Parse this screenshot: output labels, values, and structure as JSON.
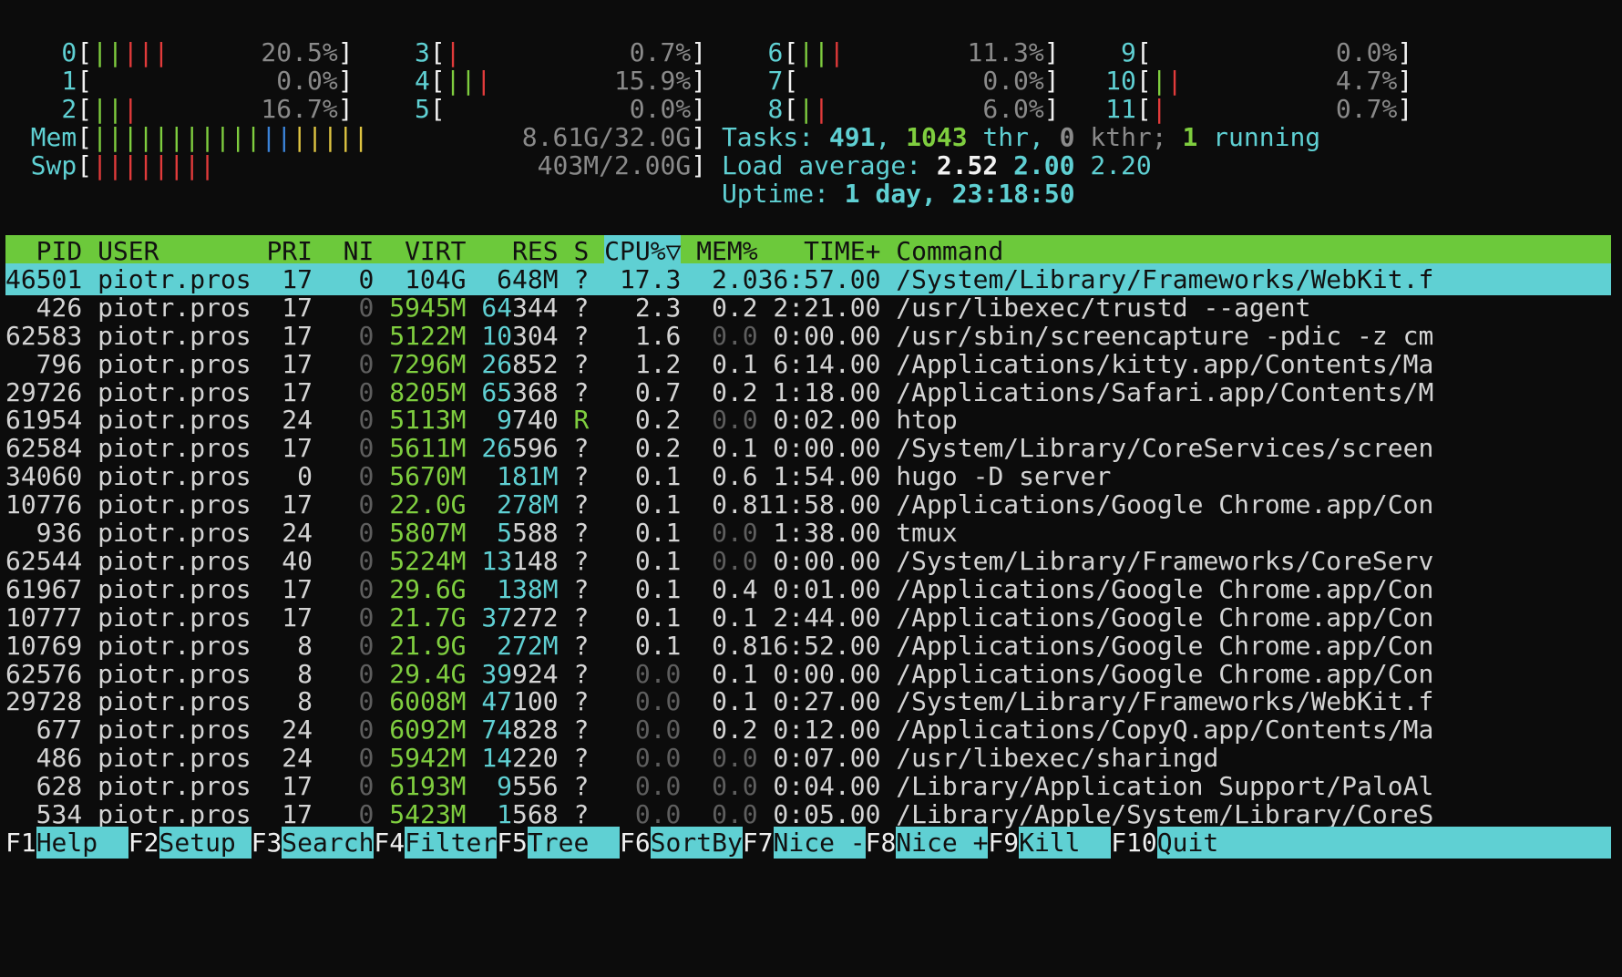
{
  "meters": {
    "cpus": [
      {
        "id": "0",
        "value": "20.5%",
        "bars": [
          [
            "green",
            2
          ],
          [
            "red",
            3
          ]
        ]
      },
      {
        "id": "1",
        "value": "0.0%",
        "bars": []
      },
      {
        "id": "2",
        "value": "16.7%",
        "bars": [
          [
            "green",
            2
          ],
          [
            "red",
            1
          ]
        ]
      },
      {
        "id": "3",
        "value": "0.7%",
        "bars": [
          [
            "red",
            1
          ]
        ]
      },
      {
        "id": "4",
        "value": "15.9%",
        "bars": [
          [
            "green",
            2
          ],
          [
            "red",
            1
          ]
        ]
      },
      {
        "id": "5",
        "value": "0.0%",
        "bars": []
      },
      {
        "id": "6",
        "value": "11.3%",
        "bars": [
          [
            "green",
            2
          ],
          [
            "red",
            1
          ]
        ]
      },
      {
        "id": "7",
        "value": "0.0%",
        "bars": []
      },
      {
        "id": "8",
        "value": "6.0%",
        "bars": [
          [
            "green",
            1
          ],
          [
            "red",
            1
          ]
        ]
      },
      {
        "id": "9",
        "value": "0.0%",
        "bars": []
      },
      {
        "id": "10",
        "value": "4.7%",
        "bars": [
          [
            "green",
            1
          ],
          [
            "red",
            1
          ]
        ]
      },
      {
        "id": "11",
        "value": "0.7%",
        "bars": [
          [
            "red",
            1
          ]
        ]
      }
    ],
    "mem": {
      "label": "Mem",
      "value": "8.61G/32.0G",
      "bars": [
        [
          "green",
          11
        ],
        [
          "blue",
          2
        ],
        [
          "yellow",
          5
        ]
      ]
    },
    "swp": {
      "label": "Swp",
      "value": "403M/2.00G",
      "bars": [
        [
          "red",
          8
        ]
      ]
    },
    "tasks": {
      "label": "Tasks: ",
      "tasks": "491",
      "sep1": ", ",
      "thr": "1043",
      "thr_label": " thr, ",
      "kthr": "0",
      "kthr_label": " kthr; ",
      "running": "1",
      "running_label": " running"
    },
    "load": {
      "label": "Load average: ",
      "l1": "2.52",
      "l5": "2.00",
      "l15": "2.20"
    },
    "uptime": {
      "label": "Uptime: ",
      "value": "1 day, 23:18:50"
    }
  },
  "table": {
    "columns": [
      "PID",
      "USER",
      "PRI",
      "NI",
      "VIRT",
      "RES",
      "S",
      "CPU%▽",
      "MEM%",
      "TIME+",
      "Command"
    ],
    "rows": [
      [
        "46501",
        "piotr.pros",
        "17",
        "0",
        "104G",
        "648M",
        "?",
        "17.3",
        "2.0",
        "36:57.00",
        "/System/Library/Frameworks/WebKit.f"
      ],
      [
        "426",
        "piotr.pros",
        "17",
        "0",
        "5945M",
        "64344",
        "?",
        "2.3",
        "0.2",
        "2:21.00",
        "/usr/libexec/trustd --agent"
      ],
      [
        "62583",
        "piotr.pros",
        "17",
        "0",
        "5122M",
        "10304",
        "?",
        "1.6",
        "0.0",
        "0:00.00",
        "/usr/sbin/screencapture -pdic -z cm"
      ],
      [
        "796",
        "piotr.pros",
        "17",
        "0",
        "7296M",
        "26852",
        "?",
        "1.2",
        "0.1",
        "6:14.00",
        "/Applications/kitty.app/Contents/Ma"
      ],
      [
        "29726",
        "piotr.pros",
        "17",
        "0",
        "8205M",
        "65368",
        "?",
        "0.7",
        "0.2",
        "1:18.00",
        "/Applications/Safari.app/Contents/M"
      ],
      [
        "61954",
        "piotr.pros",
        "24",
        "0",
        "5113M",
        "9740",
        "R",
        "0.2",
        "0.0",
        "0:02.00",
        "htop"
      ],
      [
        "62584",
        "piotr.pros",
        "17",
        "0",
        "5611M",
        "26596",
        "?",
        "0.2",
        "0.1",
        "0:00.00",
        "/System/Library/CoreServices/screen"
      ],
      [
        "34060",
        "piotr.pros",
        "0",
        "0",
        "5670M",
        "181M",
        "?",
        "0.1",
        "0.6",
        "1:54.00",
        "hugo -D server"
      ],
      [
        "10776",
        "piotr.pros",
        "17",
        "0",
        "22.0G",
        "278M",
        "?",
        "0.1",
        "0.8",
        "11:58.00",
        "/Applications/Google Chrome.app/Con"
      ],
      [
        "936",
        "piotr.pros",
        "24",
        "0",
        "5807M",
        "5588",
        "?",
        "0.1",
        "0.0",
        "1:38.00",
        "tmux"
      ],
      [
        "62544",
        "piotr.pros",
        "40",
        "0",
        "5224M",
        "13148",
        "?",
        "0.1",
        "0.0",
        "0:00.00",
        "/System/Library/Frameworks/CoreServ"
      ],
      [
        "61967",
        "piotr.pros",
        "17",
        "0",
        "29.6G",
        "138M",
        "?",
        "0.1",
        "0.4",
        "0:01.00",
        "/Applications/Google Chrome.app/Con"
      ],
      [
        "10777",
        "piotr.pros",
        "17",
        "0",
        "21.7G",
        "37272",
        "?",
        "0.1",
        "0.1",
        "2:44.00",
        "/Applications/Google Chrome.app/Con"
      ],
      [
        "10769",
        "piotr.pros",
        "8",
        "0",
        "21.9G",
        "272M",
        "?",
        "0.1",
        "0.8",
        "16:52.00",
        "/Applications/Google Chrome.app/Con"
      ],
      [
        "62576",
        "piotr.pros",
        "8",
        "0",
        "29.4G",
        "39924",
        "?",
        "0.0",
        "0.1",
        "0:00.00",
        "/Applications/Google Chrome.app/Con"
      ],
      [
        "29728",
        "piotr.pros",
        "8",
        "0",
        "6008M",
        "47100",
        "?",
        "0.0",
        "0.1",
        "0:27.00",
        "/System/Library/Frameworks/WebKit.f"
      ],
      [
        "677",
        "piotr.pros",
        "24",
        "0",
        "6092M",
        "74828",
        "?",
        "0.0",
        "0.2",
        "0:12.00",
        "/Applications/CopyQ.app/Contents/Ma"
      ],
      [
        "486",
        "piotr.pros",
        "24",
        "0",
        "5942M",
        "14220",
        "?",
        "0.0",
        "0.0",
        "0:07.00",
        "/usr/libexec/sharingd"
      ],
      [
        "628",
        "piotr.pros",
        "17",
        "0",
        "6193M",
        "9556",
        "?",
        "0.0",
        "0.0",
        "0:04.00",
        "/Library/Application Support/PaloAl"
      ],
      [
        "534",
        "piotr.pros",
        "17",
        "0",
        "5423M",
        "1568",
        "?",
        "0.0",
        "0.0",
        "0:05.00",
        "/Library/Apple/System/Library/CoreS"
      ]
    ]
  },
  "function_keys": [
    {
      "key": "F1",
      "label": "Help  "
    },
    {
      "key": "F2",
      "label": "Setup "
    },
    {
      "key": "F3",
      "label": "Search"
    },
    {
      "key": "F4",
      "label": "Filter"
    },
    {
      "key": "F5",
      "label": "Tree  "
    },
    {
      "key": "F6",
      "label": "SortBy"
    },
    {
      "key": "F7",
      "label": "Nice -"
    },
    {
      "key": "F8",
      "label": "Nice +"
    },
    {
      "key": "F9",
      "label": "Kill  "
    },
    {
      "key": "F10",
      "label": "Quit"
    }
  ],
  "colors": {
    "cyan": "#5fd0d3",
    "green": "#7fce3f",
    "red": "#e23b3b",
    "header_bg": "#6cc93b",
    "selected_bg": "#5fd0d3",
    "background": "#0c0c0c"
  }
}
